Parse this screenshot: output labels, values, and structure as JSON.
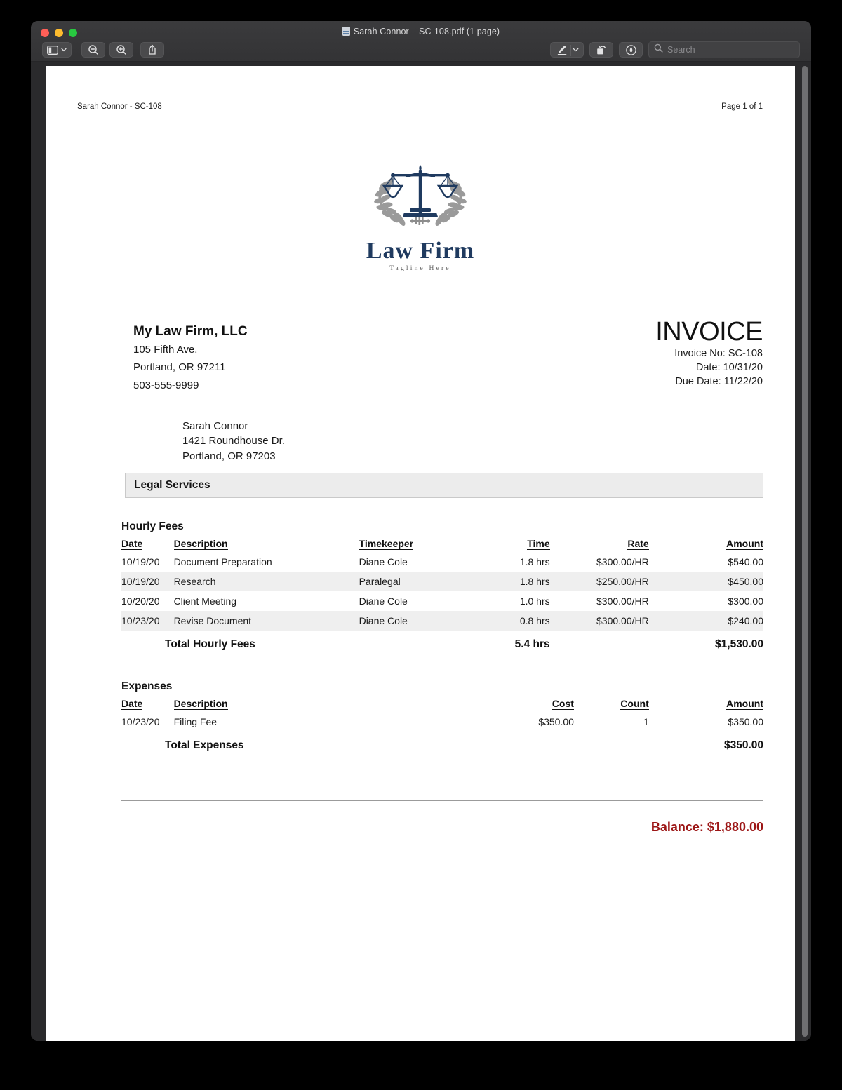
{
  "window": {
    "title": "Sarah Connor – SC-108.pdf (1 page)",
    "doc_icon": "pdf-document-icon"
  },
  "toolbar": {
    "sidebar_button": "sidebar-toggle",
    "zoom_out_button": "zoom-out",
    "zoom_in_button": "zoom-in",
    "share_button": "share",
    "markup_button": "markup",
    "rotate_button": "rotate-left",
    "annotate_button": "annotate",
    "search": {
      "placeholder": "Search",
      "value": ""
    }
  },
  "document": {
    "header_left": "Sarah Connor - SC-108",
    "header_right": "Page 1 of 1",
    "logo": {
      "name": "Law Firm",
      "tagline": "Tagline Here",
      "mark": "scales-of-justice-with-laurel-wreath",
      "color": "#1f3a5f",
      "laurel_color": "#9a9a9a"
    },
    "firm": {
      "name": "My Law Firm, LLC",
      "address1": "105 Fifth Ave.",
      "address2": "Portland, OR 97211",
      "phone": "503-555-9999"
    },
    "invoice": {
      "heading": "INVOICE",
      "number_line": "Invoice No: SC-108",
      "date_line": "Date: 10/31/20",
      "due_date_line": "Due Date: 11/22/20"
    },
    "client": {
      "name": "Sarah Connor",
      "address1": "1421 Roundhouse Dr.",
      "address2": "Portland, OR 97203"
    },
    "service_bar": "Legal Services",
    "hourly_fees": {
      "title": "Hourly Fees",
      "columns": [
        "Date",
        "Description",
        "Timekeeper",
        "Time",
        "Rate",
        "Amount"
      ],
      "rows": [
        {
          "date": "10/19/20",
          "description": "Document Preparation",
          "timekeeper": "Diane Cole",
          "time": "1.8 hrs",
          "rate": "$300.00/HR",
          "amount": "$540.00"
        },
        {
          "date": "10/19/20",
          "description": "Research",
          "timekeeper": "Paralegal",
          "time": "1.8 hrs",
          "rate": "$250.00/HR",
          "amount": "$450.00"
        },
        {
          "date": "10/20/20",
          "description": "Client Meeting",
          "timekeeper": "Diane Cole",
          "time": "1.0 hrs",
          "rate": "$300.00/HR",
          "amount": "$300.00"
        },
        {
          "date": "10/23/20",
          "description": "Revise Document",
          "timekeeper": "Diane Cole",
          "time": "0.8 hrs",
          "rate": "$300.00/HR",
          "amount": "$240.00"
        }
      ],
      "total_label": "Total Hourly Fees",
      "total_time": "5.4 hrs",
      "total_amount": "$1,530.00"
    },
    "expenses": {
      "title": "Expenses",
      "columns": [
        "Date",
        "Description",
        "Cost",
        "Count",
        "Amount"
      ],
      "rows": [
        {
          "date": "10/23/20",
          "description": "Filing Fee",
          "cost": "$350.00",
          "count": "1",
          "amount": "$350.00"
        }
      ],
      "total_label": "Total Expenses",
      "total_amount": "$350.00"
    },
    "balance": {
      "text": "Balance: $1,880.00",
      "color": "#9c1616"
    }
  }
}
